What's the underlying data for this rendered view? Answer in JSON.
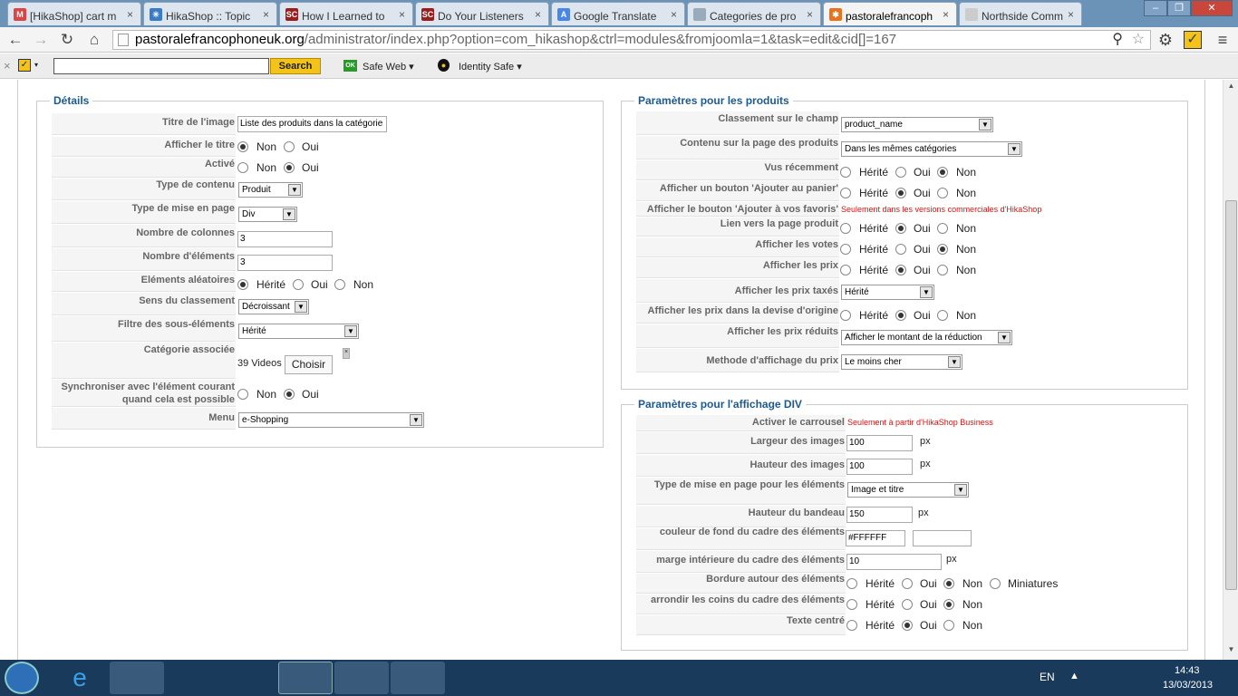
{
  "browser": {
    "tabs": [
      {
        "label": "[HikaShop] cart m",
        "icon": "gmail-icon"
      },
      {
        "label": "HikaShop :: Topic",
        "icon": "hikashop-icon"
      },
      {
        "label": "How I Learned to",
        "icon": "sc-icon"
      },
      {
        "label": "Do Your Listeners",
        "icon": "sc-icon"
      },
      {
        "label": "Google Translate",
        "icon": "translate-icon"
      },
      {
        "label": "Categories de pro",
        "icon": "page-icon"
      },
      {
        "label": "pastoralefrancoph",
        "icon": "joomla-icon"
      },
      {
        "label": "Northside Comm",
        "icon": "page-icon"
      }
    ],
    "url_host": "pastoralefrancophoneuk.org",
    "url_path": "/administrator/index.php?option=com_hikashop&ctrl=modules&fromjoomla=1&task=edit&cid[]=167"
  },
  "extbar": {
    "search_label": "Search",
    "safe_web": "Safe Web ▾",
    "identity_safe": "Identity Safe ▾",
    "ok": "OK"
  },
  "details": {
    "legend": "Détails",
    "titre_image_label": "Titre de l'image",
    "titre_image_value": "Liste des produits dans la catégorie",
    "afficher_titre_label": "Afficher le titre",
    "non": "Non",
    "oui": "Oui",
    "herite": "Hérité",
    "active_label": "Activé",
    "type_contenu_label": "Type de contenu",
    "type_contenu_value": "Produit",
    "type_mise_label": "Type de mise en page",
    "type_mise_value": "Div",
    "nb_colonnes_label": "Nombre de colonnes",
    "nb_colonnes_value": "3",
    "nb_elements_label": "Nombre d'éléments",
    "nb_elements_value": "3",
    "aleatoires_label": "Eléments aléatoires",
    "sens_label": "Sens du classement",
    "sens_value": "Décroissant",
    "filtre_label": "Filtre des sous-éléments",
    "filtre_value": "Hérité",
    "categorie_label": "Catégorie associée",
    "categorie_value": "39 Videos",
    "choisir": "Choisir",
    "sync_label1": "Synchroniser avec l'élément courant",
    "sync_label2": "quand cela est possible",
    "menu_label": "Menu",
    "menu_value": "e-Shopping"
  },
  "produits": {
    "legend": "Paramètres pour les produits",
    "classement_label": "Classement sur le champ",
    "classement_value": "product_name",
    "contenu_label": "Contenu sur la page des produits",
    "contenu_value": "Dans les mêmes catégories",
    "vus_label": "Vus récemment",
    "panier_label": "Afficher un bouton 'Ajouter au panier'",
    "favoris_label": "Afficher le bouton 'Ajouter à vos favoris'",
    "favoris_note": "Seulement dans les versions commerciales d'HikaShop",
    "lien_label": "Lien vers la page produit",
    "votes_label": "Afficher les votes",
    "prix_label": "Afficher les prix",
    "taxes_label": "Afficher les prix taxés",
    "taxes_value": "Hérité",
    "devise_label": "Afficher les prix dans la devise d'origine",
    "reduits_label": "Afficher les prix réduits",
    "reduits_value": "Afficher le montant de la réduction",
    "methode_label": "Methode d'affichage du prix",
    "methode_value": "Le moins cher"
  },
  "div": {
    "legend": "Paramètres pour l'affichage DIV",
    "carrousel_label": "Activer le carrousel",
    "carrousel_note": "Seulement à partir d'HikaShop Business",
    "largeur_label": "Largeur des images",
    "largeur_value": "100",
    "hauteur_label": "Hauteur des images",
    "hauteur_value": "100",
    "type_label": "Type de mise en page pour les éléments",
    "type_value": "Image et titre",
    "bandeau_label": "Hauteur du bandeau",
    "bandeau_value": "150",
    "couleur_label": "couleur de fond du cadre des éléments",
    "couleur_value": "#FFFFFF",
    "marge_label": "marge intérieure du cadre des éléments",
    "marge_value": "10",
    "bordure_label": "Bordure autour des éléments",
    "miniatures": "Miniatures",
    "arrondir_label": "arrondir les coins du cadre des éléments",
    "centre_label": "Texte centré",
    "px": "px"
  },
  "taskbar": {
    "lang": "EN",
    "time": "14:43",
    "date": "13/03/2013"
  }
}
